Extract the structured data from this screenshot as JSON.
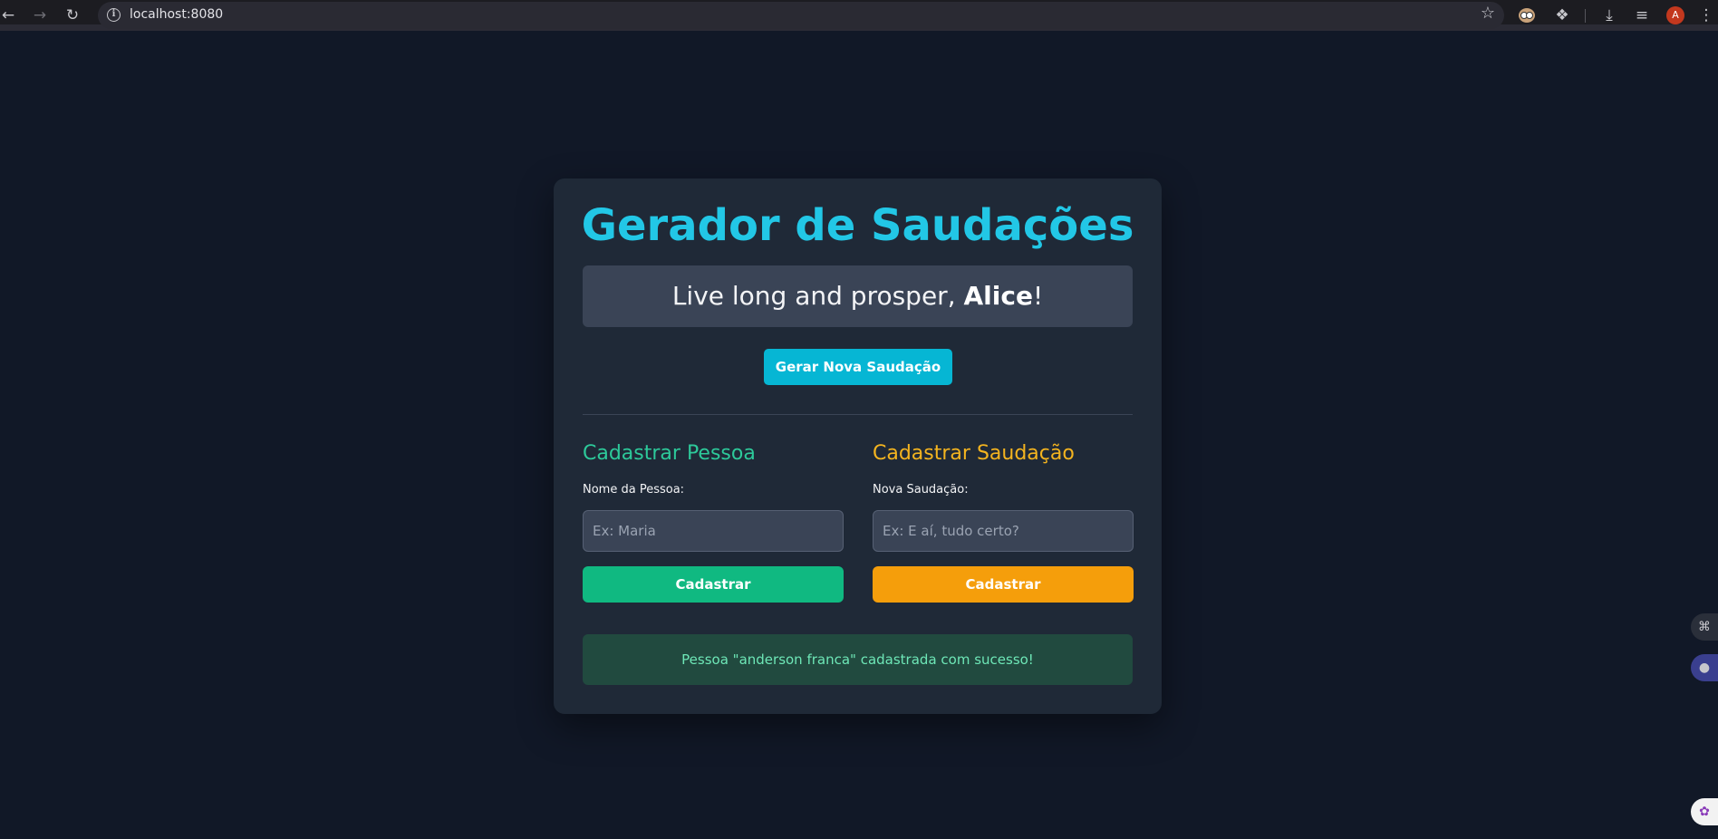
{
  "browser": {
    "url": "localhost:8080",
    "profile_initial": "A",
    "icons": {
      "back": "back-arrow-icon",
      "forward": "forward-arrow-icon",
      "reload": "reload-icon",
      "site_info": "info-icon",
      "bookmark": "star-icon",
      "extensions": "puzzle-icon",
      "downloads": "download-icon",
      "media": "media-queue-icon",
      "menu": "kebab-menu-icon"
    }
  },
  "app": {
    "title": "Gerador de Saudações",
    "greeting": {
      "prefix": "Live long and prosper, ",
      "name": "Alice",
      "suffix": "!"
    },
    "generate_button": "Gerar Nova Saudação",
    "person_form": {
      "heading": "Cadastrar Pessoa",
      "label": "Nome da Pessoa:",
      "placeholder": "Ex: Maria",
      "value": "",
      "submit": "Cadastrar"
    },
    "greeting_form": {
      "heading": "Cadastrar Saudação",
      "label": "Nova Saudação:",
      "placeholder": "Ex: E aí, tudo certo?",
      "value": "",
      "submit": "Cadastrar"
    },
    "status_message": "Pessoa \"anderson franca\" cadastrada com sucesso!"
  },
  "colors": {
    "page_bg": "#111827",
    "card_bg": "#1f2937",
    "title": "#22c7e6",
    "primary_button": "#06b6d4",
    "person_accent": "#10b981",
    "greeting_accent": "#f59e0b",
    "success_text": "#6ee7b7",
    "success_bg": "#214a3f"
  }
}
